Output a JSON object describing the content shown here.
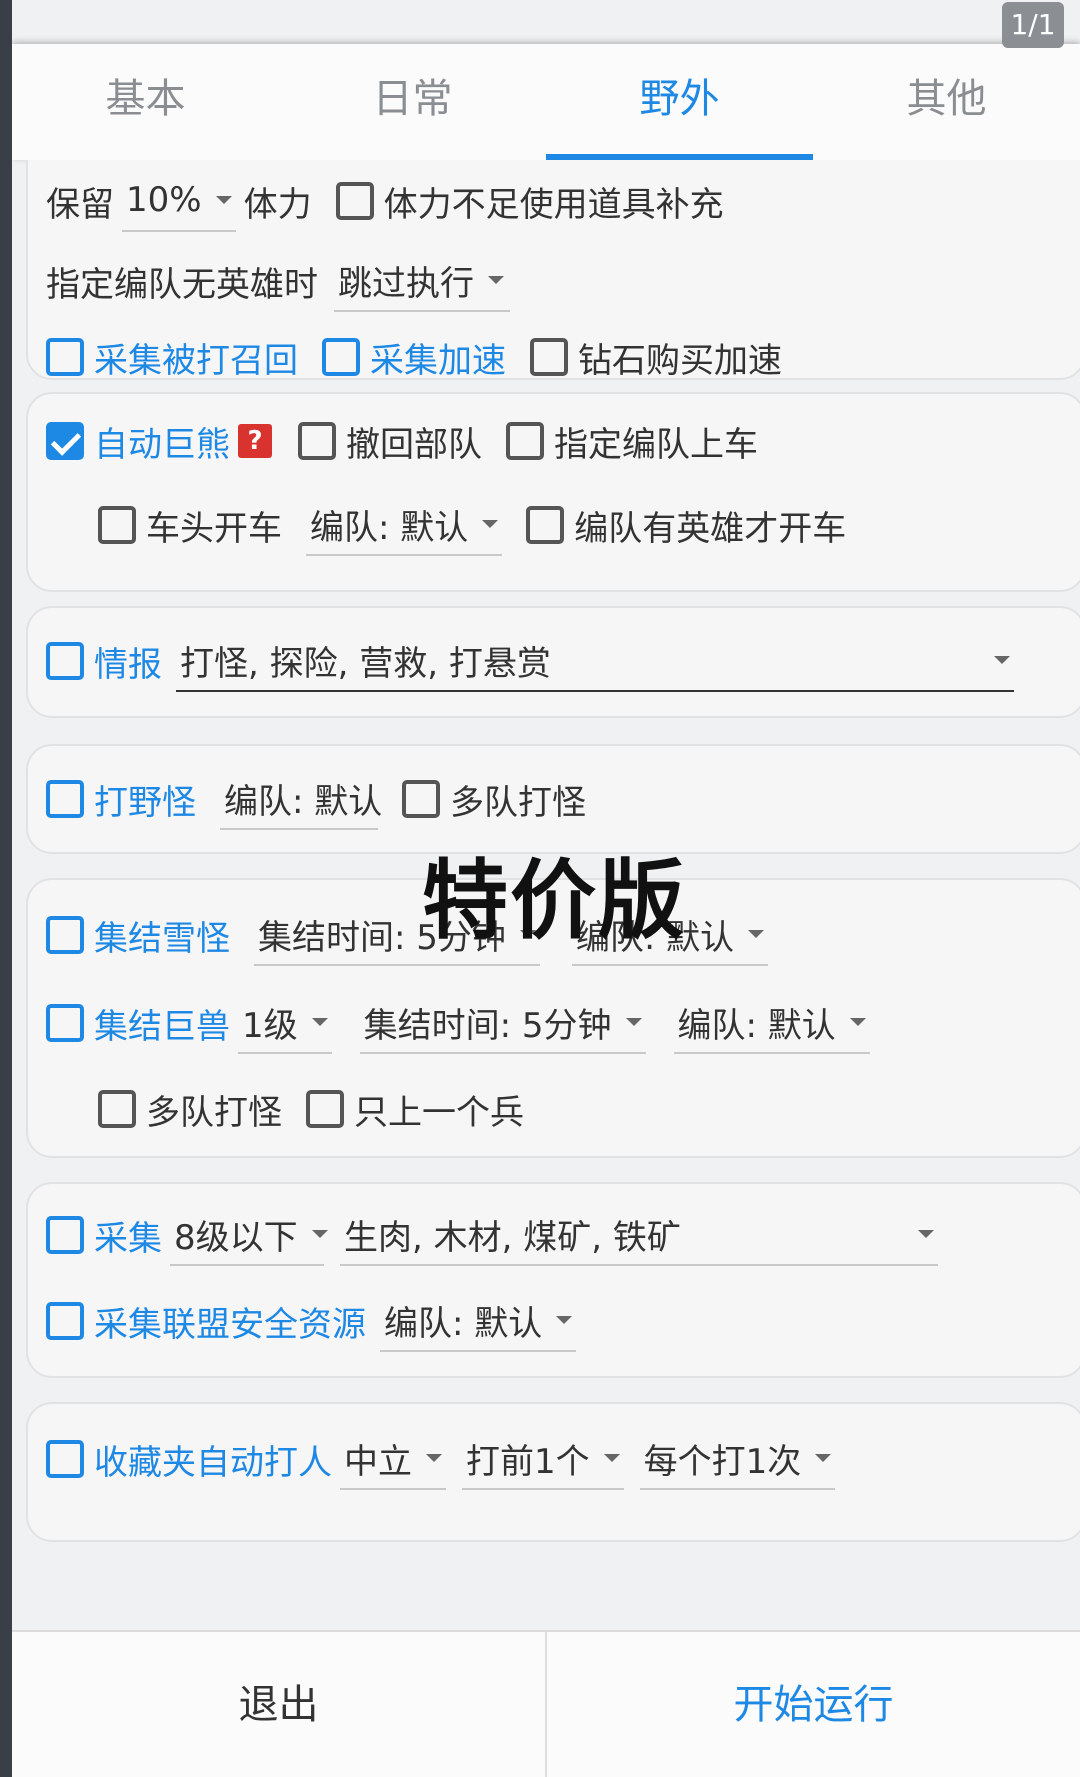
{
  "page_counter": "1/1",
  "tabs": [
    {
      "label": "基本"
    },
    {
      "label": "日常"
    },
    {
      "label": "野外"
    },
    {
      "label": "其他"
    }
  ],
  "stamina": {
    "keep_label": "保留",
    "keep_value": "10%",
    "unit_label": "体力",
    "use_item_label": "体力不足使用道具补充"
  },
  "no_hero": {
    "label": "指定编队无英雄时",
    "value": "跳过执行"
  },
  "gather_opts": {
    "recall_label": "采集被打召回",
    "speedup_label": "采集加速",
    "diamond_label": "钻石购买加速"
  },
  "bear": {
    "auto_label": "自动巨熊",
    "help_icon": "?",
    "withdraw_label": "撤回部队",
    "assign_label": "指定编队上车",
    "lead_label": "车头开车",
    "team_value": "编队: 默认",
    "hero_only_label": "编队有英雄才开车"
  },
  "intel": {
    "label": "情报",
    "value": "打怪, 探险, 营救, 打悬赏"
  },
  "monster": {
    "label": "打野怪",
    "team_value": "编队: 默认",
    "multi_label": "多队打怪"
  },
  "watermark": "特价版",
  "rally_snow": {
    "label": "集结雪怪",
    "time_value": "集结时间: 5分钟",
    "team_value": "编队: 默认"
  },
  "rally_beast": {
    "label": "集结巨兽",
    "level_value": "1级",
    "time_value": "集结时间: 5分钟",
    "team_value": "编队: 默认",
    "multi_label": "多队打怪",
    "single_label": "只上一个兵"
  },
  "gather": {
    "label": "采集",
    "level_value": "8级以下",
    "resources_value": "生肉, 木材, 煤矿, 铁矿",
    "alliance_label": "采集联盟安全资源",
    "team_value": "编队: 默认"
  },
  "favorites": {
    "label": "收藏夹自动打人",
    "type_value": "中立",
    "count_value": "打前1个",
    "times_value": "每个打1次"
  },
  "bottom": {
    "exit_label": "退出",
    "start_label": "开始运行"
  },
  "colors": {
    "accent": "#1e88e5",
    "help_badge": "#d9332f"
  }
}
